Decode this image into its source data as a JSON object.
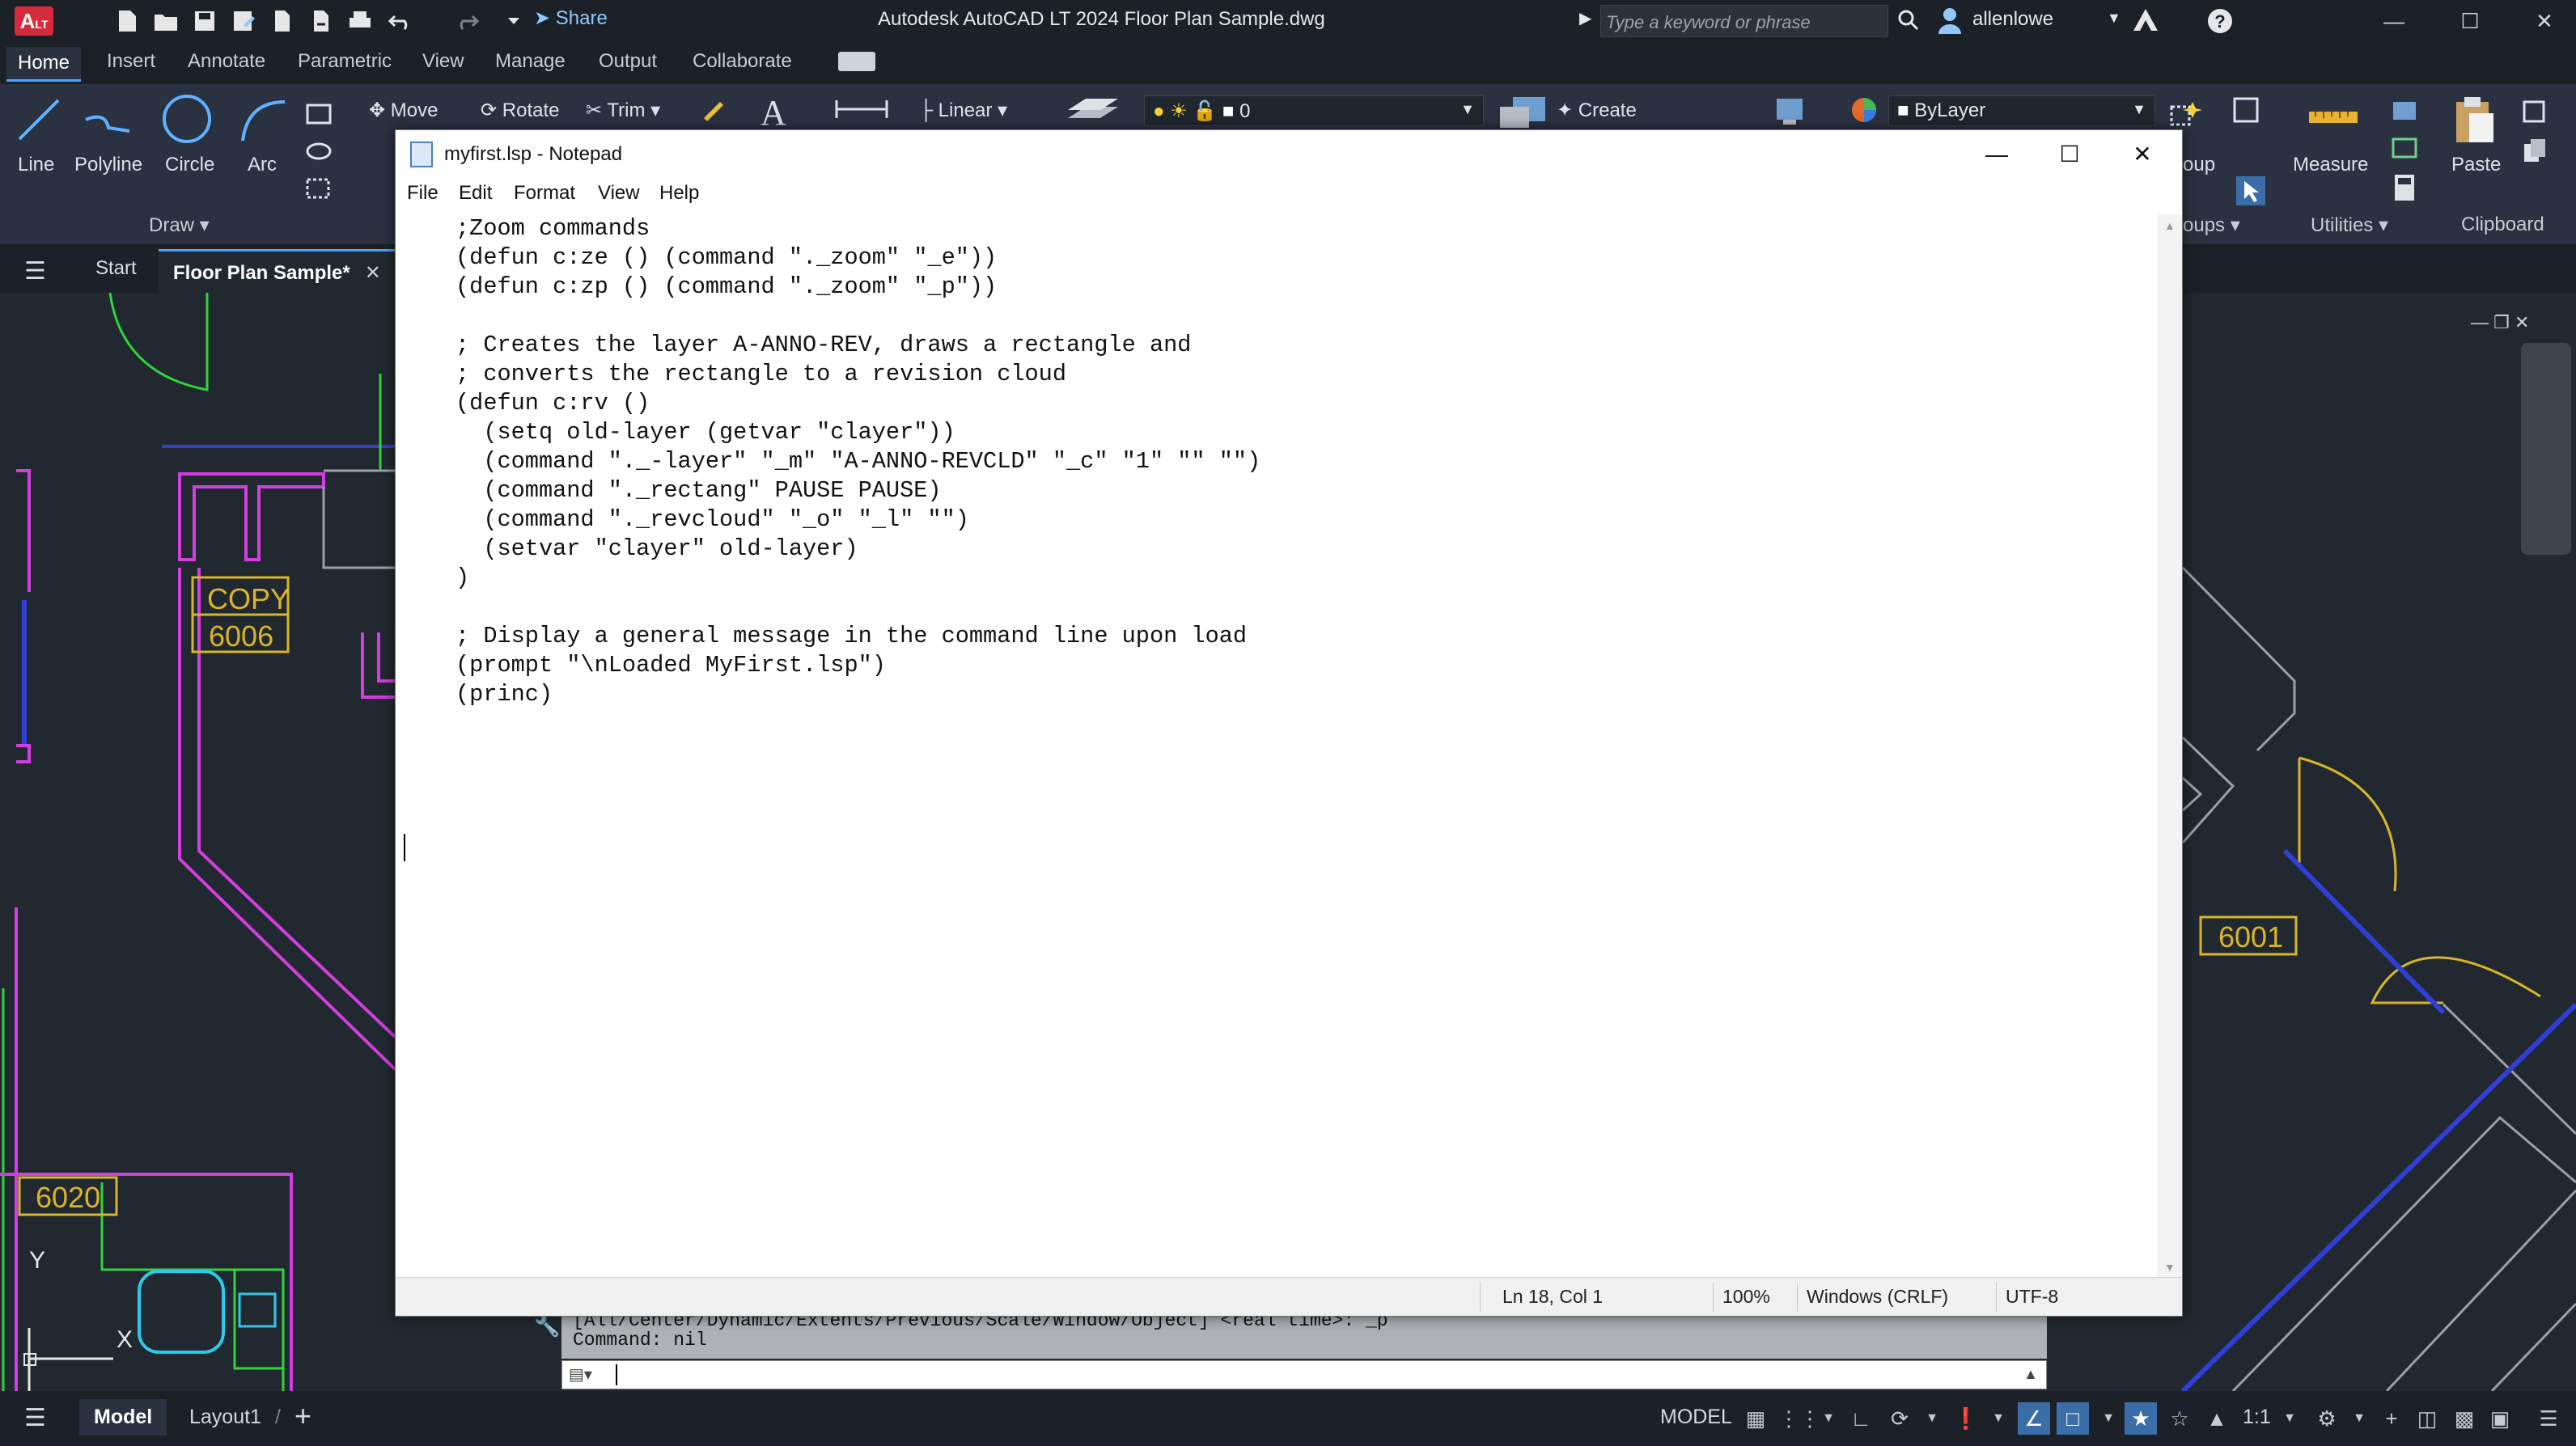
{
  "app": {
    "title": "Autodesk AutoCAD LT 2024   Floor Plan Sample.dwg",
    "logo_text": "A",
    "logo_sub": "LT",
    "share_label": "Share",
    "search_placeholder": "Type a keyword or phrase",
    "user": "allenlowe"
  },
  "ribbon_tabs": [
    "Home",
    "Insert",
    "Annotate",
    "Parametric",
    "View",
    "Manage",
    "Output",
    "Collaborate"
  ],
  "ribbon": {
    "line": "Line",
    "polyline": "Polyline",
    "circle": "Circle",
    "arc": "Arc",
    "move": "Move",
    "rotate": "Rotate",
    "trim": "Trim",
    "linear": "Linear",
    "layer_value": "0",
    "create": "Create",
    "bylayer": "ByLayer",
    "group_cut": "roup",
    "measure": "Measure",
    "paste": "Paste",
    "panel_draw": "Draw",
    "panel_groups": "roups",
    "panel_utilities": "Utilities",
    "panel_clipboard": "Clipboard"
  },
  "file_tabs": {
    "start": "Start",
    "active": "Floor Plan Sample*"
  },
  "drawing_labels": {
    "copy": "COPY",
    "room_6006": "6006",
    "room_6001": "6001",
    "room_6020": "6020",
    "ucs_y": "Y",
    "ucs_x": "X"
  },
  "notepad": {
    "title": "myfirst.lsp - Notepad",
    "menus": [
      "File",
      "Edit",
      "Format",
      "View",
      "Help"
    ],
    "content": ";Zoom commands\n(defun c:ze () (command \"._zoom\" \"_e\"))\n(defun c:zp () (command \"._zoom\" \"_p\"))\n\n; Creates the layer A-ANNO-REV, draws a rectangle and\n; converts the rectangle to a revision cloud\n(defun c:rv ()\n  (setq old-layer (getvar \"clayer\"))\n  (command \"._-layer\" \"_m\" \"A-ANNO-REVCLD\" \"_c\" \"1\" \"\" \"\")\n  (command \"._rectang\" PAUSE PAUSE)\n  (command \"._revcloud\" \"_o\" \"_l\" \"\")\n  (setvar \"clayer\" old-layer)\n)\n\n; Display a general message in the command line upon load\n(prompt \"\\nLoaded MyFirst.lsp\")\n(princ)",
    "status": {
      "position": "Ln 18, Col 1",
      "zoom": "100%",
      "line_ending": "Windows (CRLF)",
      "encoding": "UTF-8"
    }
  },
  "command": {
    "history_1": "[All/Center/Dynamic/Extents/Previous/Scale/Window/Object] <real time>: _p",
    "history_2": "Command: nil"
  },
  "statusbar": {
    "model_tab": "Model",
    "layout_tab": "Layout1",
    "model_label": "MODEL",
    "scale": "1:1"
  },
  "colors": {
    "accent": "#4ea1ff",
    "magenta": "#d23ee0",
    "green": "#32d23c",
    "yellow": "#d9b52a",
    "blue": "#2f3fd8",
    "cyan": "#2ec8e8"
  }
}
